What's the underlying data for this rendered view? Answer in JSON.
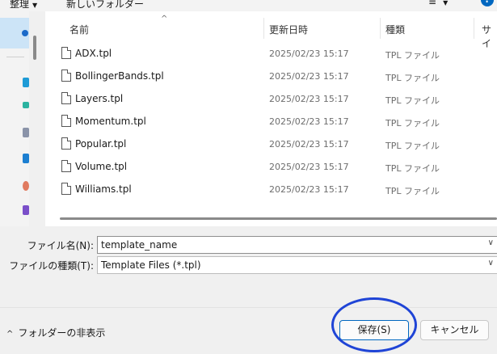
{
  "toolbar": {
    "organize_label": "整理",
    "organize_caret": "▼",
    "new_folder_label": "新しいフォルダー",
    "view_icon": "≡",
    "view_caret": "▼",
    "help_glyph": "?"
  },
  "columns": {
    "name": "名前",
    "date": "更新日時",
    "type": "種類",
    "size": "サイ"
  },
  "sort_arrow": "^",
  "files": [
    {
      "name": "ADX.tpl",
      "date": "2025/02/23 15:17",
      "type": "TPL ファイル"
    },
    {
      "name": "BollingerBands.tpl",
      "date": "2025/02/23 15:17",
      "type": "TPL ファイル"
    },
    {
      "name": "Layers.tpl",
      "date": "2025/02/23 15:17",
      "type": "TPL ファイル"
    },
    {
      "name": "Momentum.tpl",
      "date": "2025/02/23 15:17",
      "type": "TPL ファイル"
    },
    {
      "name": "Popular.tpl",
      "date": "2025/02/23 15:17",
      "type": "TPL ファイル"
    },
    {
      "name": "Volume.tpl",
      "date": "2025/02/23 15:17",
      "type": "TPL ファイル"
    },
    {
      "name": "Williams.tpl",
      "date": "2025/02/23 15:17",
      "type": "TPL ファイル"
    }
  ],
  "form": {
    "filename_label": "ファイル名(N):",
    "filename_value": "template_name",
    "filetype_label": "ファイルの種類(T):",
    "filetype_value": "Template Files (*.tpl)",
    "dropdown_glyph": "∨"
  },
  "footer": {
    "hide_folders_label": "フォルダーの非表示",
    "hide_folders_glyph": "^",
    "save_label": "保存(S)",
    "cancel_label": "キャンセル"
  },
  "colors": {
    "accent": "#0067c0",
    "highlight_circle": "#1f44d6",
    "nav_selected": "#cce4f7",
    "nav_icons": [
      "#1e9bd6",
      "#2bb3a0",
      "#8a93a8",
      "#1c7fd1",
      "#e07a5f",
      "#7a4fc9"
    ]
  },
  "icons": {
    "file_icon": "document-icon",
    "help_icon": "help-icon",
    "view_icon": "list-view-icon"
  }
}
